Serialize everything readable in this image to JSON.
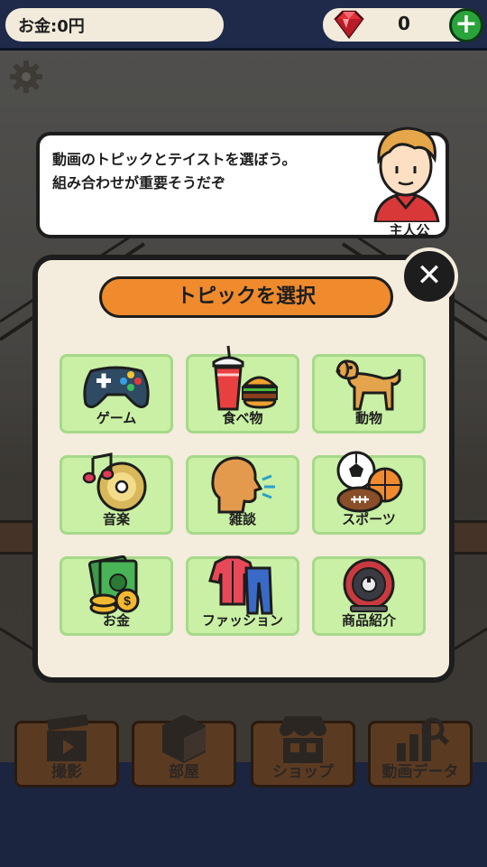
{
  "topbar": {
    "money_label": "お金:0円",
    "gem_count": "0",
    "plus_label": "+"
  },
  "speech": {
    "text": "動画のトピックとテイストを選ぼう。\n組み合わせが重要そうだぞ",
    "character_name": "主人公"
  },
  "modal": {
    "title": "トピックを選択",
    "close_label": "✕",
    "topics": [
      {
        "label": "ゲーム",
        "icon": "gamepad-icon"
      },
      {
        "label": "食べ物",
        "icon": "food-icon"
      },
      {
        "label": "動物",
        "icon": "dog-icon"
      },
      {
        "label": "音楽",
        "icon": "music-icon"
      },
      {
        "label": "雑談",
        "icon": "talk-icon"
      },
      {
        "label": "スポーツ",
        "icon": "sports-balls-icon"
      },
      {
        "label": "お金",
        "icon": "money-icon"
      },
      {
        "label": "ファッション",
        "icon": "clothes-icon"
      },
      {
        "label": "商品紹介",
        "icon": "robot-vacuum-icon"
      }
    ]
  },
  "bottom_nav": [
    {
      "label": "撮影",
      "icon": "clapperboard-icon"
    },
    {
      "label": "部屋",
      "icon": "room-icon"
    },
    {
      "label": "ショップ",
      "icon": "shop-icon"
    },
    {
      "label": "動画データ",
      "icon": "analytics-icon"
    }
  ],
  "colors": {
    "topic_tile": "#c9f0a4",
    "title_pill": "#ef8b2c",
    "modal_bg": "#f4ecdc"
  }
}
